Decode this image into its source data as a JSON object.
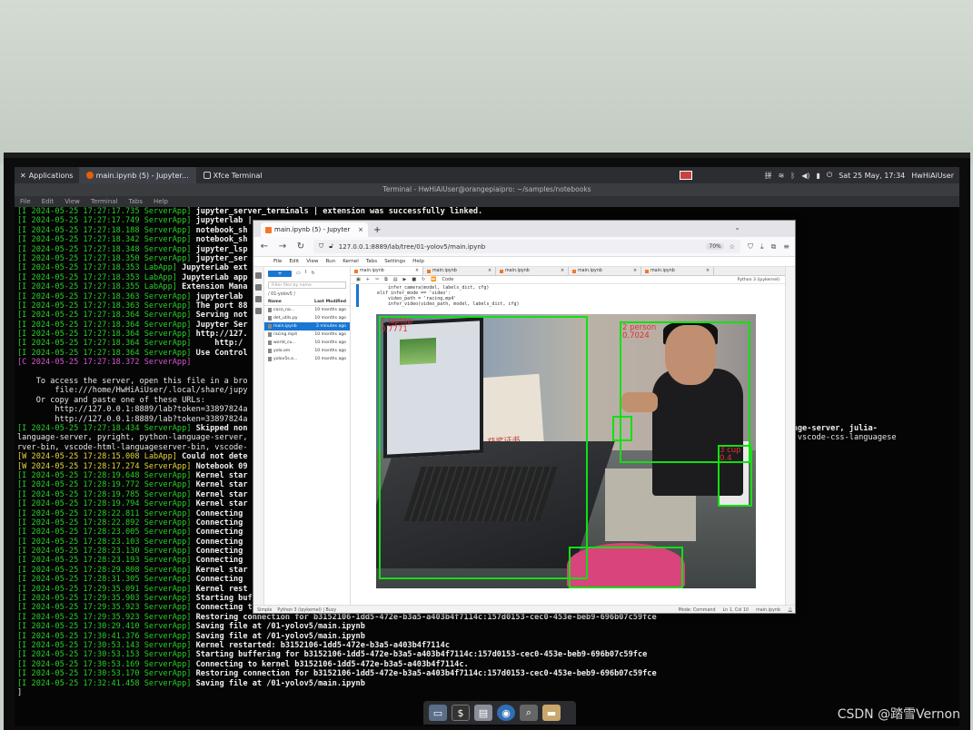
{
  "xfce_panel": {
    "applications_label": "Applications",
    "task_firefox": "main.ipynb (5) - Jupyter...",
    "task_terminal": "Xfce Terminal",
    "clock": "Sat 25 May, 17:34",
    "user": "HwHiAiUser"
  },
  "terminal": {
    "title": "Terminal - HwHiAiUser@orangepiaipro: ~/samples/notebooks",
    "menu": [
      "File",
      "Edit",
      "View",
      "Terminal",
      "Tabs",
      "Help"
    ],
    "lines": [
      {
        "level": "I",
        "prefix": "[I 2024-05-25 17:27:17.735 ServerApp]",
        "text": " jupyter_server_terminals | extension was successfully linked."
      },
      {
        "level": "I",
        "prefix": "[I 2024-05-25 17:27:17.749 ServerApp]",
        "text": " jupyterlab | "
      },
      {
        "level": "I",
        "prefix": "[I 2024-05-25 17:27:18.188 ServerApp]",
        "text": " notebook_sh"
      },
      {
        "level": "I",
        "prefix": "[I 2024-05-25 17:27:18.342 ServerApp]",
        "text": " notebook_sh"
      },
      {
        "level": "I",
        "prefix": "[I 2024-05-25 17:27:18.348 ServerApp]",
        "text": " jupyter_lsp"
      },
      {
        "level": "I",
        "prefix": "[I 2024-05-25 17:27:18.350 ServerApp]",
        "text": " jupyter_ser"
      },
      {
        "level": "I",
        "prefix": "[I 2024-05-25 17:27:18.353 LabApp]",
        "text": " JupyterLab ext"
      },
      {
        "level": "I",
        "prefix": "[I 2024-05-25 17:27:18.353 LabApp]",
        "text": " JupyterLab app"
      },
      {
        "level": "I",
        "prefix": "[I 2024-05-25 17:27:18.355 LabApp]",
        "text": " Extension Mana"
      },
      {
        "level": "I",
        "prefix": "[I 2024-05-25 17:27:18.363 ServerApp]",
        "text": " jupyterlab"
      },
      {
        "level": "I",
        "prefix": "[I 2024-05-25 17:27:18.363 ServerApp]",
        "text": " The port 88"
      },
      {
        "level": "I",
        "prefix": "[I 2024-05-25 17:27:18.364 ServerApp]",
        "text": " Serving not"
      },
      {
        "level": "I",
        "prefix": "[I 2024-05-25 17:27:18.364 ServerApp]",
        "text": " Jupyter Ser"
      },
      {
        "level": "I",
        "prefix": "[I 2024-05-25 17:27:18.364 ServerApp]",
        "text": " http://127."
      },
      {
        "level": "I",
        "prefix": "[I 2024-05-25 17:27:18.364 ServerApp]",
        "text": "     http:/"
      },
      {
        "level": "I",
        "prefix": "[I 2024-05-25 17:27:18.364 ServerApp]",
        "text": " Use Control"
      },
      {
        "level": "C",
        "prefix": "[C 2024-05-25 17:27:18.372 ServerApp]",
        "text": ""
      },
      {
        "level": "P",
        "prefix": "",
        "text": ""
      },
      {
        "level": "P",
        "prefix": "",
        "text": "    To access the server, open this file in a bro"
      },
      {
        "level": "P",
        "prefix": "",
        "text": "        file:///home/HwHiAiUser/.local/share/jupy"
      },
      {
        "level": "P",
        "prefix": "",
        "text": "    Or copy and paste one of these URLs:"
      },
      {
        "level": "P",
        "prefix": "",
        "text": "        http://127.0.0.1:8889/lab?token=33897824a"
      },
      {
        "level": "P",
        "prefix": "",
        "text": "        http://127.0.0.1:8889/lab?token=33897824a"
      },
      {
        "level": "I",
        "prefix": "[I 2024-05-25 17:27:18.434 ServerApp]",
        "text": " Skipped non                                                                                                  server, jedi-language-server, julia-"
      },
      {
        "level": "P",
        "prefix": "",
        "text": "language-server, pyright, python-language-server,                                                                                                      nguage-server, vscode-css-languagese"
      },
      {
        "level": "P",
        "prefix": "",
        "text": "rver-bin, vscode-html-languageserver-bin, vscode-"
      },
      {
        "level": "W",
        "prefix": "[W 2024-05-25 17:28:15.008 LabApp]",
        "text": " Could not dete"
      },
      {
        "level": "W",
        "prefix": "[W 2024-05-25 17:28:17.274 ServerApp]",
        "text": " Notebook 09"
      },
      {
        "level": "I",
        "prefix": "[I 2024-05-25 17:28:19.648 ServerApp]",
        "text": " Kernel star"
      },
      {
        "level": "I",
        "prefix": "[I 2024-05-25 17:28:19.772 ServerApp]",
        "text": " Kernel star"
      },
      {
        "level": "I",
        "prefix": "[I 2024-05-25 17:28:19.785 ServerApp]",
        "text": " Kernel star"
      },
      {
        "level": "I",
        "prefix": "[I 2024-05-25 17:28:19.794 ServerApp]",
        "text": " Kernel star"
      },
      {
        "level": "I",
        "prefix": "[I 2024-05-25 17:28:22.811 ServerApp]",
        "text": " Connecting"
      },
      {
        "level": "I",
        "prefix": "[I 2024-05-25 17:28:22.892 ServerApp]",
        "text": " Connecting"
      },
      {
        "level": "I",
        "prefix": "[I 2024-05-25 17:28:23.005 ServerApp]",
        "text": " Connecting"
      },
      {
        "level": "I",
        "prefix": "[I 2024-05-25 17:28:23.103 ServerApp]",
        "text": " Connecting"
      },
      {
        "level": "I",
        "prefix": "[I 2024-05-25 17:28:23.130 ServerApp]",
        "text": " Connecting"
      },
      {
        "level": "I",
        "prefix": "[I 2024-05-25 17:28:23.193 ServerApp]",
        "text": " Connecting"
      },
      {
        "level": "I",
        "prefix": "[I 2024-05-25 17:28:29.808 ServerApp]",
        "text": " Kernel star"
      },
      {
        "level": "I",
        "prefix": "[I 2024-05-25 17:28:31.305 ServerApp]",
        "text": " Connecting"
      },
      {
        "level": "I",
        "prefix": "[I 2024-05-25 17:29:35.091 ServerApp]",
        "text": " Kernel rest"
      },
      {
        "level": "I",
        "prefix": "[I 2024-05-25 17:29:35.903 ServerApp]",
        "text": " Starting buffering for b3152106-1dd5-472e-b3a5-a403b4f7114c:157d0153-cec0-453e-beb9-696b07c59fce"
      },
      {
        "level": "I",
        "prefix": "[I 2024-05-25 17:29:35.923 ServerApp]",
        "text": " Connecting to kernel b3152106-1dd5-472e-b3a5-a403b4f7114c."
      },
      {
        "level": "I",
        "prefix": "[I 2024-05-25 17:29:35.923 ServerApp]",
        "text": " Restoring connection for b3152106-1dd5-472e-b3a5-a403b4f7114c:157d0153-cec0-453e-beb9-696b07c59fce"
      },
      {
        "level": "I",
        "prefix": "[I 2024-05-25 17:30:29.410 ServerApp]",
        "text": " Saving file at /01-yolov5/main.ipynb"
      },
      {
        "level": "I",
        "prefix": "[I 2024-05-25 17:30:41.376 ServerApp]",
        "text": " Saving file at /01-yolov5/main.ipynb"
      },
      {
        "level": "I",
        "prefix": "[I 2024-05-25 17:30:53.143 ServerApp]",
        "text": " Kernel restarted: b3152106-1dd5-472e-b3a5-a403b4f7114c"
      },
      {
        "level": "I",
        "prefix": "[I 2024-05-25 17:30:53.153 ServerApp]",
        "text": " Starting buffering for b3152106-1dd5-472e-b3a5-a403b4f7114c:157d0153-cec0-453e-beb9-696b07c59fce"
      },
      {
        "level": "I",
        "prefix": "[I 2024-05-25 17:30:53.169 ServerApp]",
        "text": " Connecting to kernel b3152106-1dd5-472e-b3a5-a403b4f7114c."
      },
      {
        "level": "I",
        "prefix": "[I 2024-05-25 17:30:53.170 ServerApp]",
        "text": " Restoring connection for b3152106-1dd5-472e-b3a5-a403b4f7114c:157d0153-cec0-453e-beb9-696b07c59fce"
      },
      {
        "level": "I",
        "prefix": "[I 2024-05-25 17:32:41.458 ServerApp]",
        "text": " Saving file at /01-yolov5/main.ipynb"
      },
      {
        "level": "P",
        "prefix": "",
        "text": "]"
      }
    ]
  },
  "firefox": {
    "tab_title": "main.ipynb (5) - Jupyter",
    "url": "127.0.0.1:8889/lab/tree/01-yolov5/main.ipynb",
    "zoom": "70%"
  },
  "jupyter": {
    "menu": [
      "File",
      "Edit",
      "View",
      "Run",
      "Kernel",
      "Tabs",
      "Settings",
      "Help"
    ],
    "filter_placeholder": "Filter files by name",
    "path": "/ 01-yolov5 /",
    "col_name": "Name",
    "col_modified": "Last Modified",
    "files": [
      {
        "name": "coco_na...",
        "modified": "10 months ago",
        "selected": false
      },
      {
        "name": "det_utils.py",
        "modified": "10 months ago",
        "selected": false
      },
      {
        "name": "main.ipynb",
        "modified": "2 minutes ago",
        "selected": true
      },
      {
        "name": "racing.mp4",
        "modified": "10 months ago",
        "selected": false
      },
      {
        "name": "world_cu...",
        "modified": "10 months ago",
        "selected": false
      },
      {
        "name": "yolo.om",
        "modified": "10 months ago",
        "selected": false
      },
      {
        "name": "yolov5s.o...",
        "modified": "10 months ago",
        "selected": false
      }
    ],
    "notebook_tabs": [
      "main.ipynb",
      "main.ipynb",
      "main.ipynb",
      "main.ipynb",
      "main.ipynb"
    ],
    "cell_type": "Code",
    "kernel": "Python 3 (ipykernel)",
    "code_lines": [
      "    infer_camera(model, labels_dict, cfg)",
      "elif infer_mode == 'video':",
      "    video_path = 'racing.mp4'",
      "    infer_video(video_path, model, labels_dict, cfg)"
    ],
    "status_left": "Simple",
    "status_kernel": "Python 3 (ipykernel) | Busy",
    "status_mode": "Mode: Command",
    "status_pos": "Ln 1, Col 10",
    "status_file": "main.ipynb"
  },
  "detections": [
    {
      "label": "1 laptop",
      "score": "0.7771"
    },
    {
      "label": "2 person",
      "score": "0.7024"
    },
    {
      "label": "3 cup",
      "score": "0.4"
    },
    {
      "label": "",
      "score": ""
    },
    {
      "label": "",
      "score": ""
    }
  ],
  "detection_image_text": "获奖证书",
  "watermark": "CSDN @踏雪Vernon"
}
